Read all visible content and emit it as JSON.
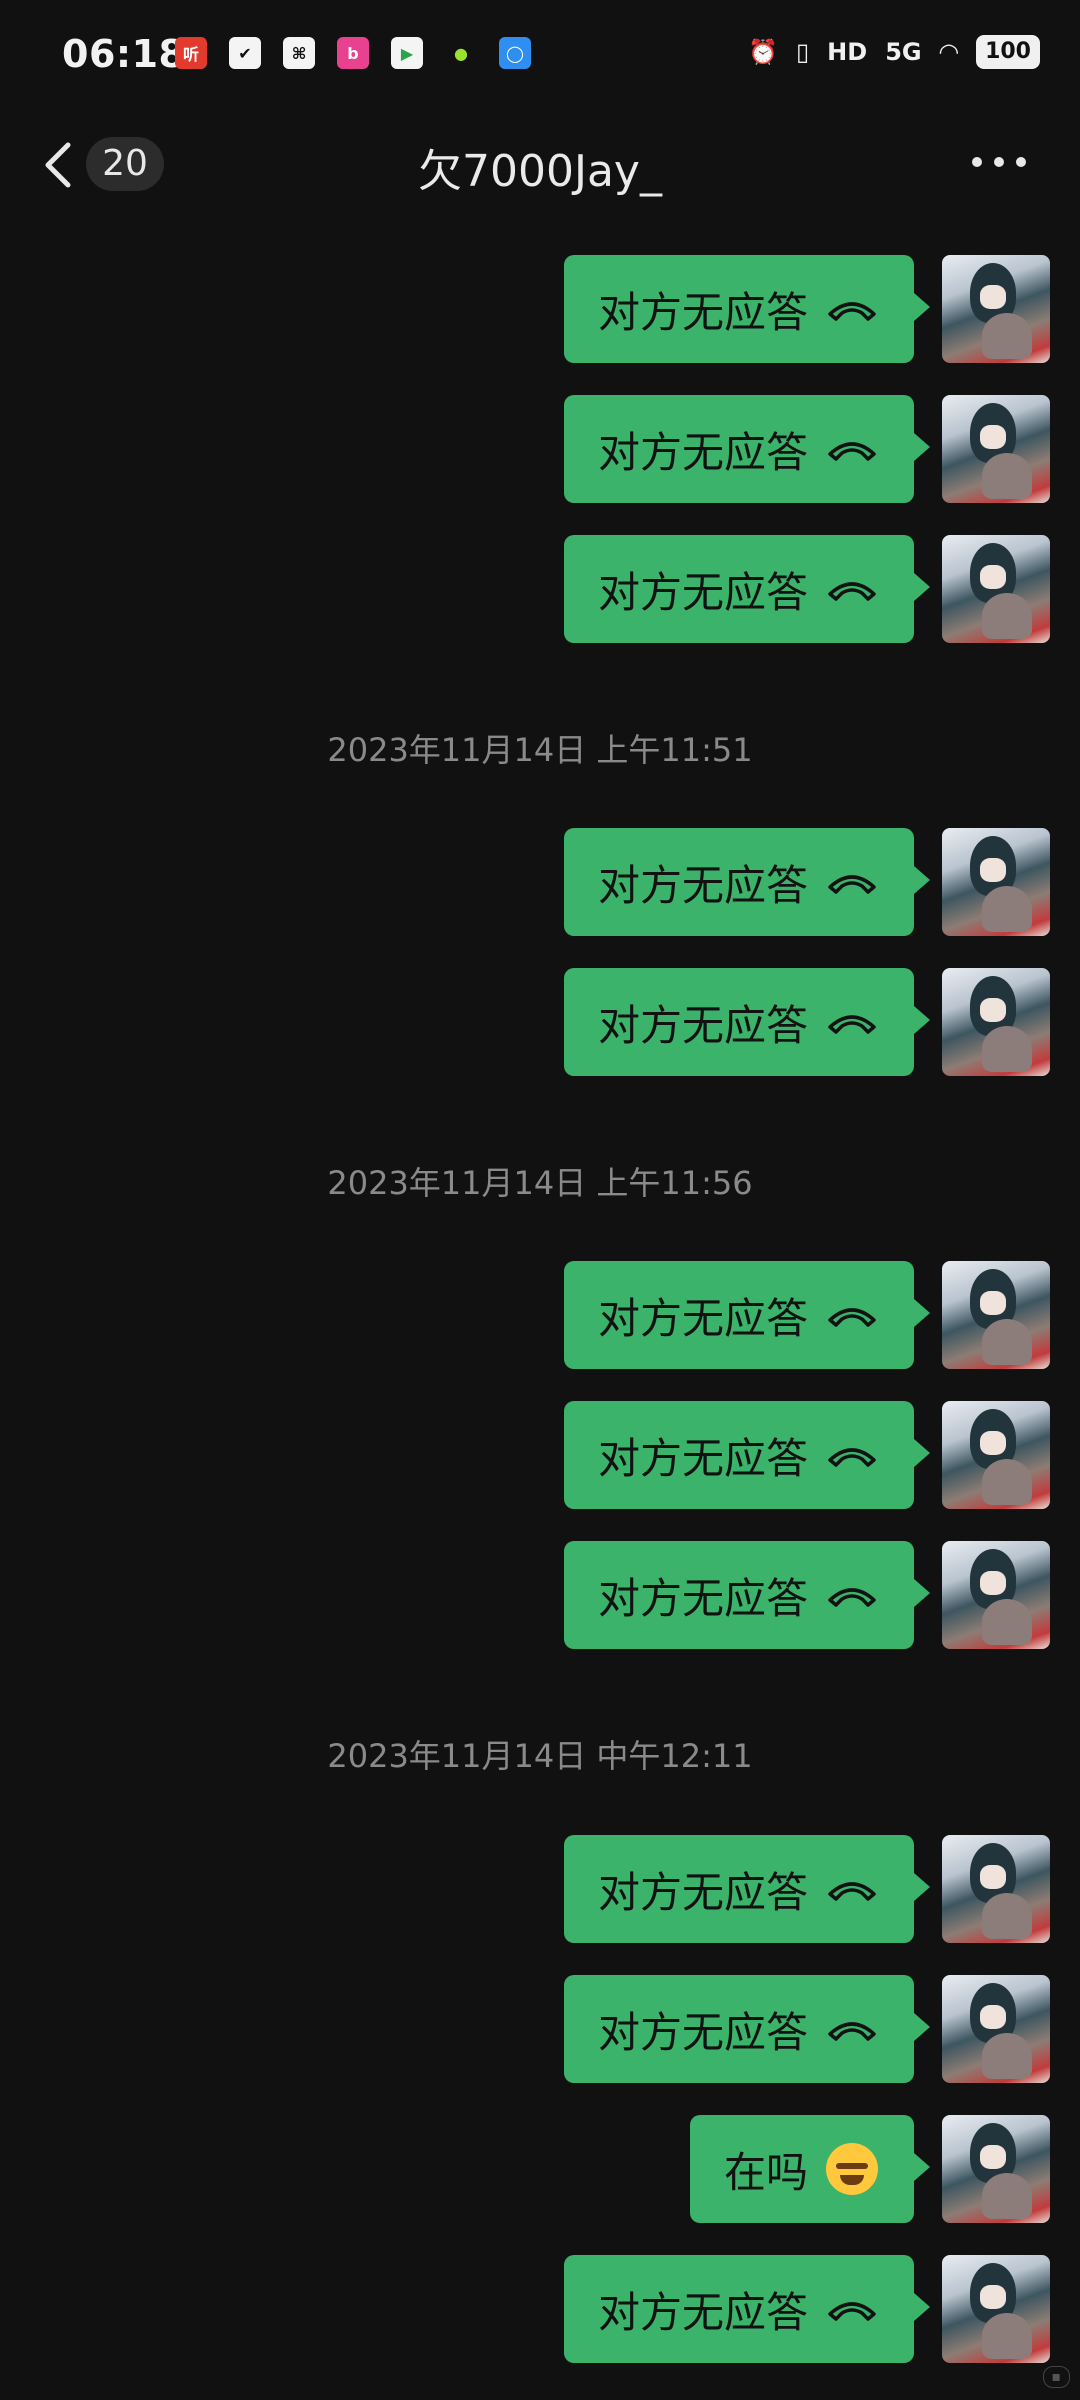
{
  "status_bar": {
    "time": "06:18",
    "network": "5G",
    "hd": "HD",
    "battery": "100"
  },
  "header": {
    "unread_count": "20",
    "title": "欠7000Jay_"
  },
  "timestamps": [
    "2023年11月14日 上午11:51",
    "2023年11月14日 上午11:56",
    "2023年11月14日 中午12:11"
  ],
  "messages": {
    "call_status": "对方无应答",
    "text_1": "在吗"
  },
  "colors": {
    "background": "#111111",
    "bubble": "#3bb36a",
    "timestamp": "#8a8a8a"
  }
}
